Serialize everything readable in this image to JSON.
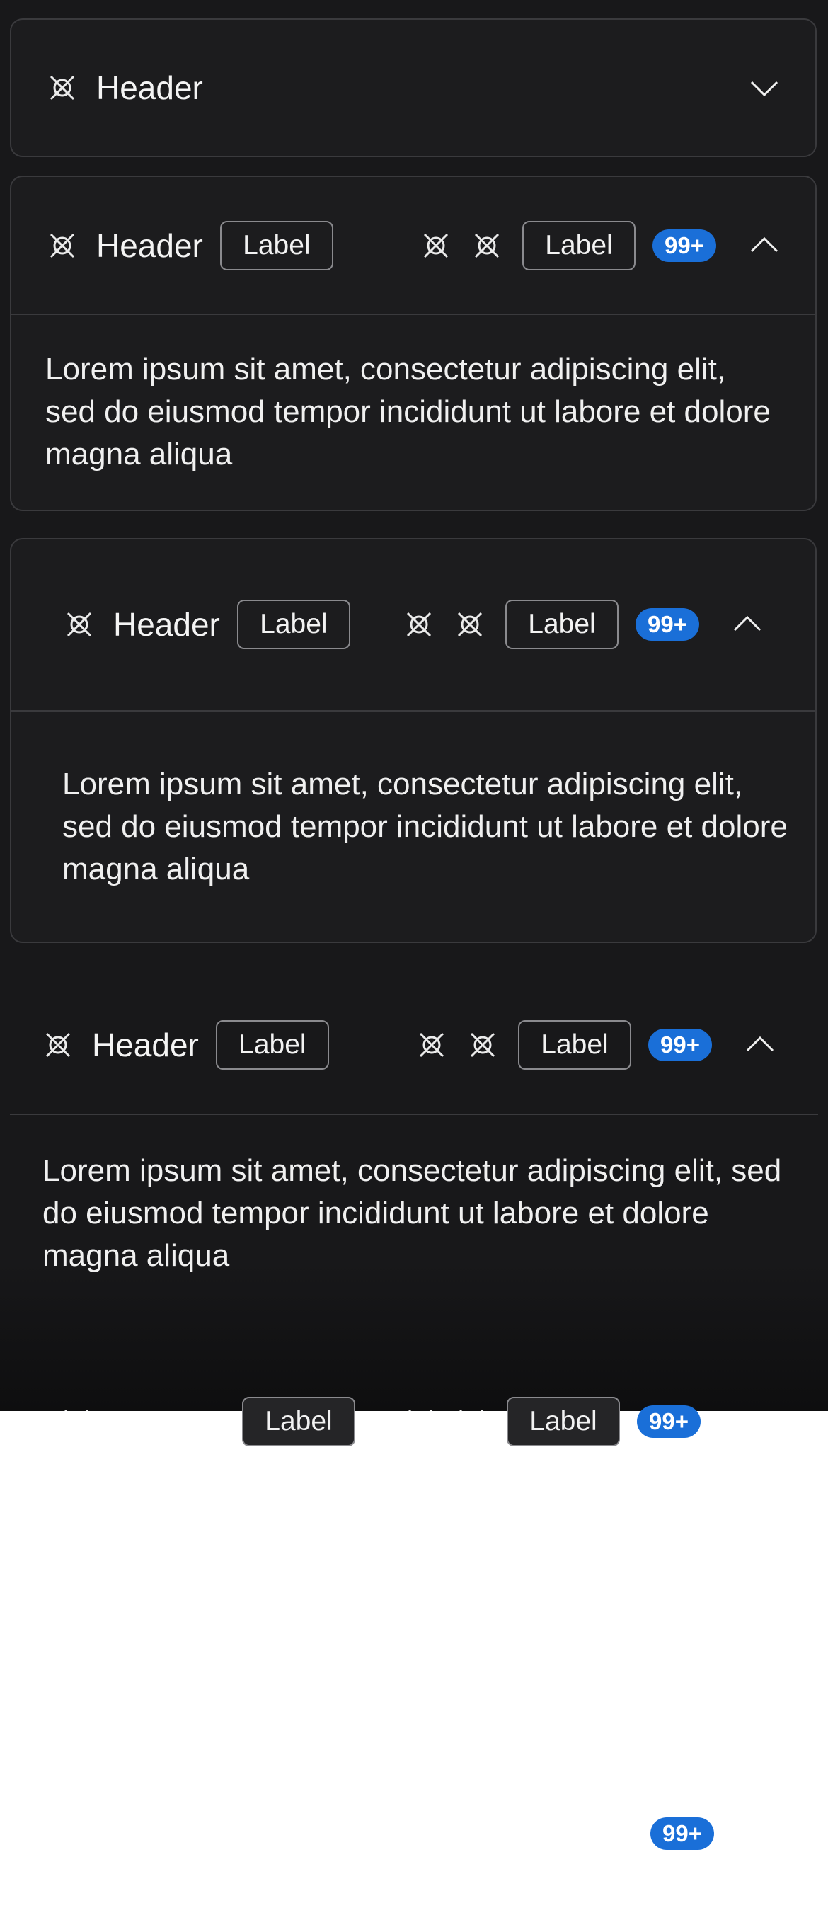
{
  "accordions": [
    {
      "header": "Header",
      "expanded": false
    },
    {
      "header": "Header",
      "label": "Label",
      "right_label": "Label",
      "badge": "99+",
      "expanded": true,
      "body": "Lorem ipsum sit amet, consectetur adipiscing elit, sed do eiusmod tempor incididunt ut labore et dolore magna aliqua"
    },
    {
      "header": "Header",
      "label": "Label",
      "right_label": "Label",
      "badge": "99+",
      "expanded": true,
      "body": "Lorem ipsum sit amet, consectetur adipiscing elit, sed do eiusmod tempor incididunt ut labore et dolore magna aliqua"
    },
    {
      "header": "Header",
      "label": "Label",
      "right_label": "Label",
      "badge": "99+",
      "expanded": true,
      "body": "Lorem ipsum sit amet, consectetur adipiscing elit, sed do eiusmod tempor incididunt ut labore et dolore magna aliqua"
    }
  ],
  "floating": {
    "label_a": "Label",
    "label_b": "Label",
    "badge": "99+",
    "bottom_badge": "99+"
  },
  "colors": {
    "background": "#18181a",
    "border": "#3a3a3d",
    "badge": "#1a6fd8"
  },
  "icons": {
    "placeholder": "x-circle-placeholder-icon",
    "collapse": "chevron-up-icon",
    "expand": "chevron-down-icon"
  }
}
